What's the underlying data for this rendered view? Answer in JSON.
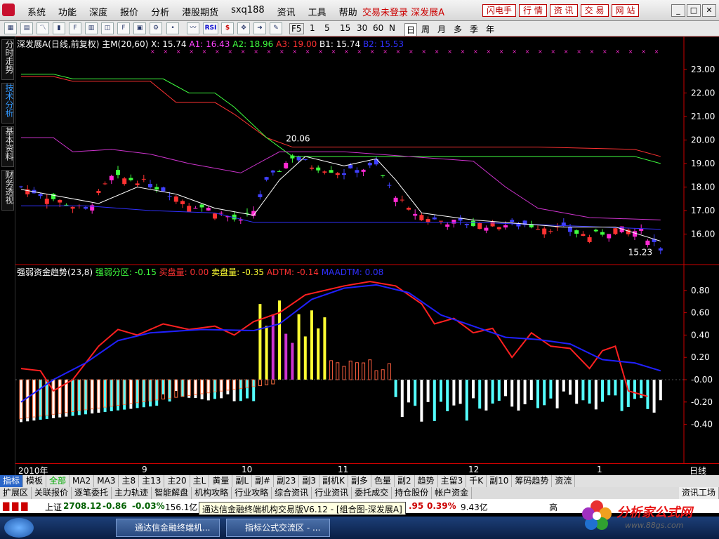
{
  "menu": {
    "items": [
      "系统",
      "功能",
      "深度",
      "报价",
      "分析",
      "港股期货",
      "sxq188",
      "资讯",
      "工具",
      "帮助"
    ],
    "status": "交易未登录  深发展A",
    "right_buttons": [
      "闪电手",
      "行  情",
      "资  讯",
      "交  易",
      "网  站"
    ],
    "window_buttons": [
      "_",
      "□",
      "✕"
    ]
  },
  "toolbar": {
    "periods": [
      "F5",
      "1",
      "5",
      "15",
      "30",
      "60",
      "N",
      "日",
      "周",
      "月",
      "多",
      "季",
      "年"
    ],
    "icons": [
      "RSI",
      "$"
    ]
  },
  "sidetabs": [
    "分时走势",
    "技术分析",
    "基本资料",
    "财务透视"
  ],
  "main_header": {
    "title": "深发展A(日线,前复权) 主M(20,60)",
    "x": "X: 15.74",
    "a1": "A1: 16.43",
    "a2": "A2: 18.96",
    "a3": "A3: 19.00",
    "b1": "B1: 15.74",
    "b2": "B2: 15.53"
  },
  "main_axis": {
    "ticks": [
      "23.00",
      "22.00",
      "21.00",
      "20.00",
      "19.00",
      "18.00",
      "17.00",
      "16.00"
    ],
    "high_label": "20.06",
    "low_label": "15.23"
  },
  "sub_header": {
    "title": "强弱资金趋势(23,8)",
    "v1": "强弱分区: -0.15",
    "v2": "买盘量: 0.00",
    "v3": "卖盘量: -0.35",
    "v4": "ADTM: -0.14",
    "v5": "MAADTM: 0.08"
  },
  "sub_axis": {
    "ticks": [
      "0.80",
      "0.60",
      "0.40",
      "0.20",
      "-0.00",
      "-0.20",
      "-0.40"
    ]
  },
  "time_axis": {
    "labels": [
      "2010年",
      "9",
      "10",
      "11",
      "12",
      "1"
    ],
    "right": "日线"
  },
  "index_tabs": [
    "指标",
    "模板",
    "全部",
    "MA2",
    "MA3",
    "主8",
    "主13",
    "主20",
    "主L",
    "黄量",
    "副L",
    "副#",
    "副23",
    "副3",
    "副机K",
    "副多",
    "色量",
    "副2",
    "趋势",
    "主留3",
    "千K",
    "副10",
    "筹码趋势",
    "资流"
  ],
  "func_tabs": [
    "扩展区",
    "关联报价",
    "逐笔委托",
    "主力轨迹",
    "智能解盘",
    "机构攻略",
    "行业攻略",
    "综合资讯",
    "行业资讯",
    "委托成交",
    "持仓股份",
    "帐户资金"
  ],
  "func_right": "资讯工场",
  "ticker": {
    "name": "上证",
    "price": "2708.12",
    "chg": "-0.86",
    "pct": "-0.03%",
    "vol": "156.1亿",
    "r1": ".95",
    "r2": "0.39%",
    "r3": "9.43亿",
    "r4": "高"
  },
  "tooltip": "通达信金融终端机构交易版V6.12 - [组合图-深发展A]",
  "taskbar": {
    "items": [
      "通达信金融终端机...",
      "指标公式交流区 - ..."
    ]
  },
  "watermark": {
    "title": "分析家公式网",
    "url": "www.88gs.com"
  },
  "colors": {
    "up": "#ff3232",
    "down": "#54ffff",
    "green_candle": "#3fff3f",
    "pink": "#ff2ad4",
    "blue": "#3030ff",
    "magenta": "#cc33cc"
  }
}
